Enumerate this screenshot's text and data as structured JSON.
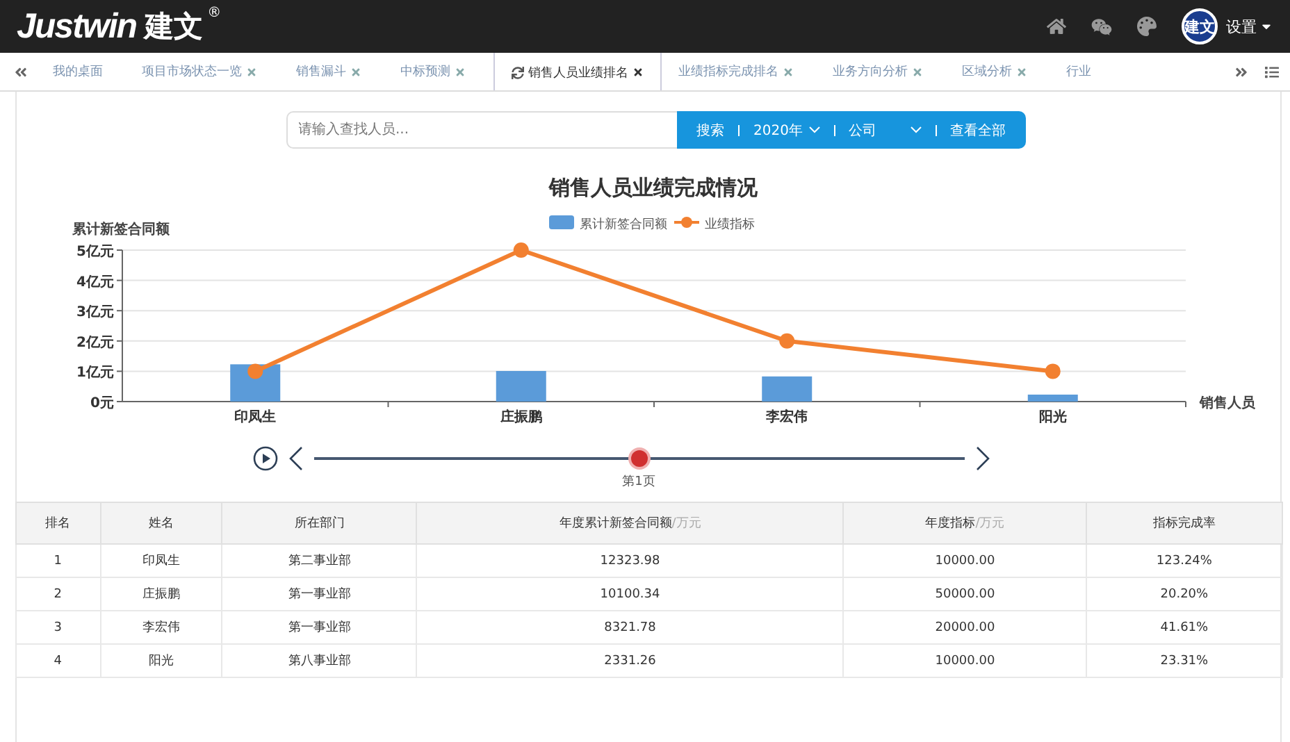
{
  "header": {
    "logo": "Justwin",
    "logo_cn": "建文",
    "registered": "®",
    "avatar": "建文",
    "settings": "设置"
  },
  "tabs": [
    {
      "label": "我的桌面",
      "selected": false,
      "closable": false
    },
    {
      "label": "项目市场状态一览",
      "selected": false,
      "closable": true
    },
    {
      "label": "销售漏斗",
      "selected": false,
      "closable": true
    },
    {
      "label": "中标预测",
      "selected": false,
      "closable": true
    },
    {
      "label": "销售人员业绩排名",
      "selected": true,
      "closable": true
    },
    {
      "label": "业绩指标完成排名",
      "selected": false,
      "closable": true
    },
    {
      "label": "业务方向分析",
      "selected": false,
      "closable": true
    },
    {
      "label": "区域分析",
      "selected": false,
      "closable": true
    },
    {
      "label": "行业",
      "selected": false,
      "closable": false
    }
  ],
  "search": {
    "placeholder": "请输入查找人员...",
    "button": "搜索",
    "year": "2020年",
    "scope": "公司",
    "view_all": "查看全部"
  },
  "chart": {
    "chart_data": {
      "type": "bar",
      "title": "销售人员业绩完成情况",
      "xlabel": "销售人员",
      "ylabel": "累计新签合同额",
      "categories": [
        "印凤生",
        "庄振鹏",
        "李宏伟",
        "阳光"
      ],
      "series": [
        {
          "name": "累计新签合同额",
          "color": "#5b9bd9",
          "type": "bar",
          "values": [
            1.23,
            1.01,
            0.83,
            0.23
          ]
        },
        {
          "name": "业绩指标",
          "color": "#f28030",
          "type": "line",
          "marker": "circle",
          "values": [
            1,
            5,
            2,
            1
          ]
        }
      ],
      "legend": true,
      "grid": "y",
      "ylim": [
        0,
        5
      ],
      "yticks": [
        {
          "value": 0,
          "label": "0元"
        },
        {
          "value": 1,
          "label": "1亿元"
        },
        {
          "value": 2,
          "label": "2亿元"
        },
        {
          "value": 3,
          "label": "3亿元"
        },
        {
          "value": 4,
          "label": "4亿元"
        },
        {
          "value": 5,
          "label": "5亿元"
        }
      ]
    }
  },
  "timeline": {
    "page_label": "第1页",
    "level": 0.5
  },
  "table": {
    "columns": [
      {
        "label": "排名"
      },
      {
        "label": "姓名"
      },
      {
        "label": "所在部门"
      },
      {
        "label": "年度累计新签合同额",
        "unit": "/万元"
      },
      {
        "label": "年度指标",
        "unit": "/万元"
      },
      {
        "label": "指标完成率"
      }
    ],
    "rows": [
      [
        "1",
        "印凤生",
        "第二事业部",
        "12323.98",
        "10000.00",
        "123.24%"
      ],
      [
        "2",
        "庄振鹏",
        "第一事业部",
        "10100.34",
        "50000.00",
        "20.20%"
      ],
      [
        "3",
        "李宏伟",
        "第一事业部",
        "8321.78",
        "20000.00",
        "41.61%"
      ],
      [
        "4",
        "阳光",
        "第八事业部",
        "2331.26",
        "10000.00",
        "23.31%"
      ]
    ]
  }
}
